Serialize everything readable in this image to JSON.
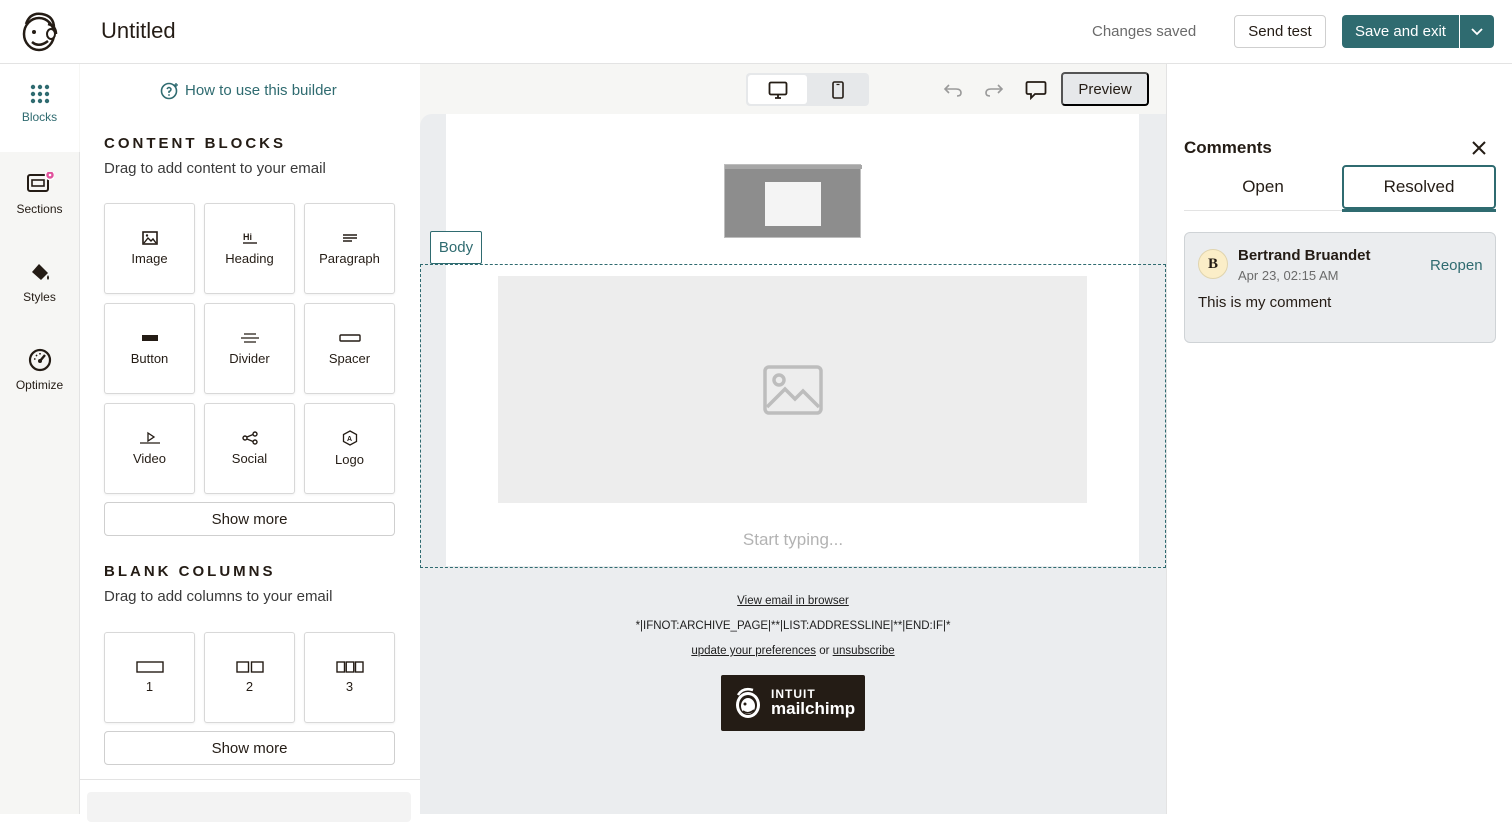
{
  "header": {
    "title": "Untitled",
    "status": "Changes saved",
    "send_test": "Send test",
    "save_and_exit": "Save and exit"
  },
  "rail": {
    "items": [
      {
        "label": "Blocks",
        "icon": "grid-dots-icon"
      },
      {
        "label": "Sections",
        "icon": "sections-icon"
      },
      {
        "label": "Styles",
        "icon": "paint-bucket-icon"
      },
      {
        "label": "Optimize",
        "icon": "gauge-icon"
      }
    ]
  },
  "panel": {
    "howto": "How to use this builder",
    "content_blocks": {
      "heading": "CONTENT BLOCKS",
      "subtitle": "Drag to add content to your email",
      "tiles": [
        "Image",
        "Heading",
        "Paragraph",
        "Button",
        "Divider",
        "Spacer",
        "Video",
        "Social",
        "Logo"
      ],
      "show_more": "Show more"
    },
    "blank_columns": {
      "heading": "BLANK COLUMNS",
      "subtitle": "Drag to add columns to your email",
      "tiles": [
        "1",
        "2",
        "3"
      ],
      "show_more": "Show more"
    }
  },
  "canvas": {
    "preview": "Preview",
    "body_tag": "Body",
    "start_typing": "Start typing...",
    "footer": {
      "view_browser": "View email in browser",
      "merge_tag": "*|IFNOT:ARCHIVE_PAGE|**|LIST:ADDRESSLINE|**|END:IF|*",
      "update_prefs": "update your preferences",
      "or": "or",
      "unsubscribe": "unsubscribe",
      "badge_line1": "INTUIT",
      "badge_line2": "mailchimp"
    }
  },
  "comments": {
    "title": "Comments",
    "tabs": [
      "Open",
      "Resolved"
    ],
    "active_tab": "Resolved",
    "items": [
      {
        "avatar": "B",
        "author": "Bertrand Bruandet",
        "date": "Apr 23, 02:15 AM",
        "action": "Reopen",
        "text": "This is my comment"
      }
    ]
  },
  "colors": {
    "accent": "#2f6b70",
    "notification_dot": "#e0529c"
  }
}
